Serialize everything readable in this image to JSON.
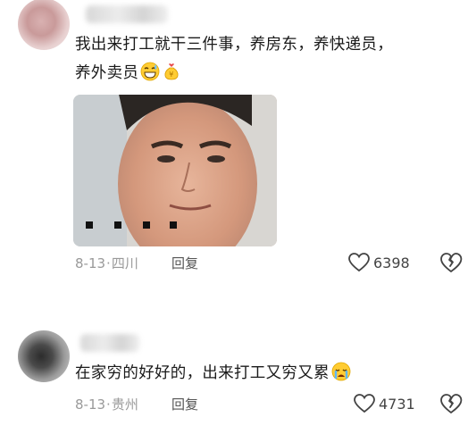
{
  "comments": [
    {
      "text_line1": "我出来打工就干三件事，养房东，养快递员，",
      "text_line2": "养外卖员",
      "date": "8-13",
      "location": "四川",
      "reply_label": "回复",
      "like_count": "6398",
      "emojis": [
        "grinning-sweat-emoji",
        "money-bag-emoji"
      ]
    },
    {
      "text": "在家穷的好好的，出来打工又穷又累",
      "date": "8-13",
      "location": "贵州",
      "reply_label": "回复",
      "like_count": "4731",
      "emojis": [
        "crying-emoji"
      ]
    }
  ],
  "colors": {
    "meta_gray": "#9a9a9a",
    "text": "#1a1a1a"
  }
}
